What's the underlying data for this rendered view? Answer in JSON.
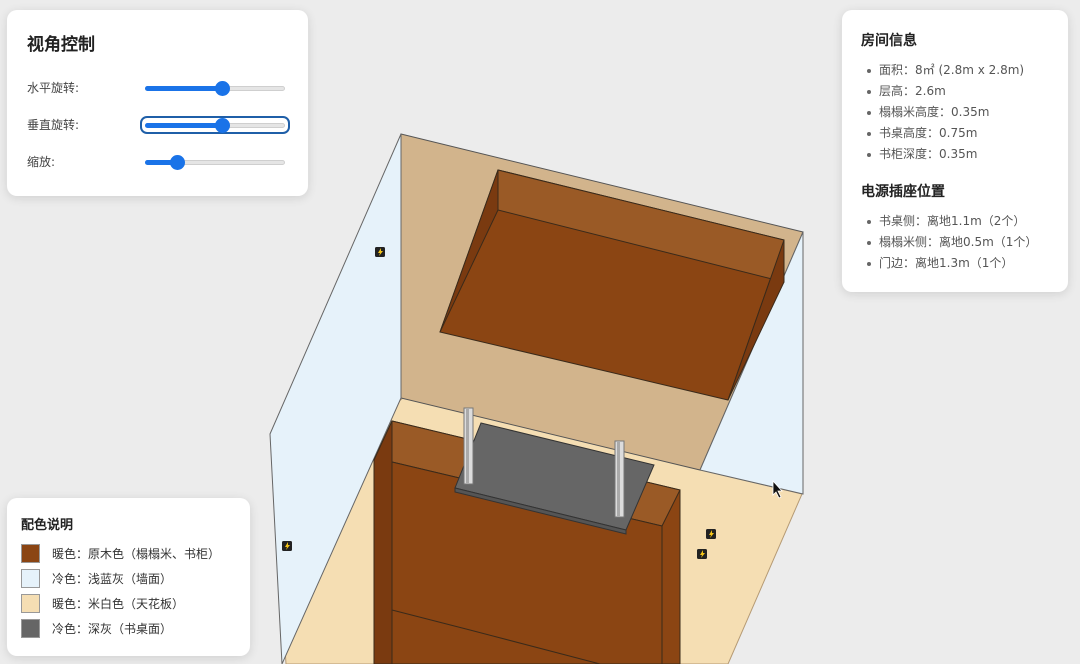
{
  "view_control": {
    "title": "视角控制",
    "sliders": [
      {
        "label": "水平旋转:",
        "value": 0.55
      },
      {
        "label": "垂直旋转:",
        "value": 0.55
      },
      {
        "label": "缩放:",
        "value": 0.23
      }
    ]
  },
  "room_info": {
    "title": "房间信息",
    "items": [
      "面积：8㎡ (2.8m x 2.8m)",
      "层高：2.6m",
      "榻榻米高度：0.35m",
      "书桌高度：0.75m",
      "书柜深度：0.35m"
    ],
    "power_title": "电源插座位置",
    "power_items": [
      "书桌侧：离地1.1m（2个）",
      "榻榻米侧：离地0.5m（1个）",
      "门边：离地1.3m（1个）"
    ]
  },
  "legend": {
    "title": "配色说明",
    "items": [
      {
        "label": "暖色：原木色（榻榻米、书柜）",
        "color": "#8b4513"
      },
      {
        "label": "冷色：浅蓝灰（墙面）",
        "color": "#e6f2fa"
      },
      {
        "label": "暖色：米白色（天花板）",
        "color": "#f5deb3"
      },
      {
        "label": "冷色：深灰（书桌面）",
        "color": "#666666"
      }
    ]
  },
  "colors": {
    "wood": "#8b4513",
    "wall": "#e6f2fa",
    "ceiling": "#f5deb3",
    "desk": "#666666",
    "back_wall": "#d2b48c",
    "accent": "#1a73e8"
  }
}
